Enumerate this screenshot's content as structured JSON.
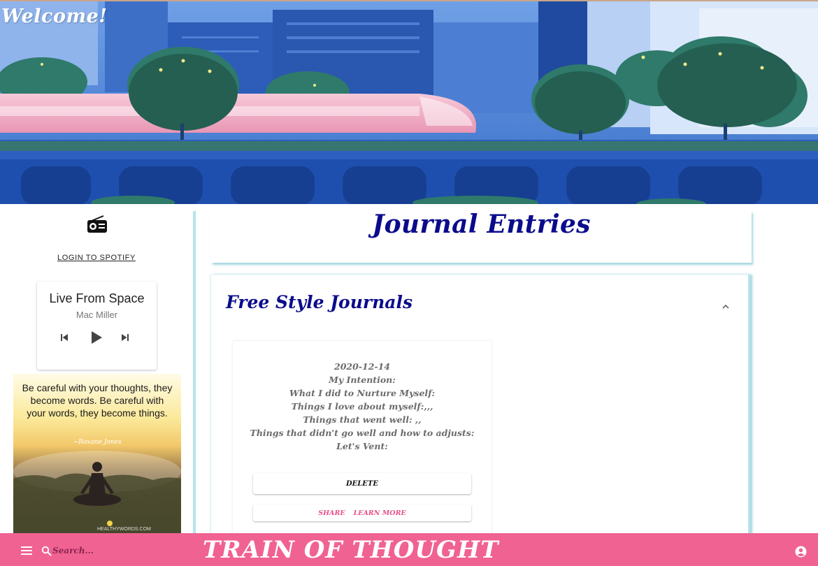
{
  "header": {
    "welcome": "Welcome!"
  },
  "sidebar": {
    "radio_icon": "radio-icon",
    "login_link": "LOGIN TO SPOTIFY",
    "player": {
      "title": "Live From Space",
      "artist": "Mac Miller",
      "controls": [
        "skip-previous-icon",
        "play-icon",
        "skip-next-icon"
      ]
    },
    "quote": {
      "text": "Be careful with your thoughts, they become words. Be careful with your words, they become things.",
      "author": "~Roxane Jones",
      "site": "HEALTHYWORDS.COM"
    }
  },
  "main": {
    "title": "Journal Entries",
    "section": {
      "title": "Free Style Journals",
      "collapse_icon": "chevron-up-icon",
      "entry": {
        "date": "2020-12-14",
        "lines": [
          "My Intention:",
          "What I did to Nurture Myself:",
          "Things I love about myself:,,,",
          "Things that went well: ,,",
          "Things that didn't go well and how to adjusts:",
          "Let's Vent:"
        ],
        "delete_label": "DELETE",
        "share_label": "SHARE",
        "learn_more_label": "LEARN MORE"
      }
    }
  },
  "footer": {
    "menu_icon": "menu-icon",
    "search_icon": "search-icon",
    "search_placeholder": "Search...",
    "brand": "TRAIN OF THOUGHT",
    "account_icon": "account-circle-icon"
  },
  "colors": {
    "accent_pink": "#f06292",
    "title_navy": "#0b0b8c",
    "card_shadow": "#b6e4ec"
  }
}
